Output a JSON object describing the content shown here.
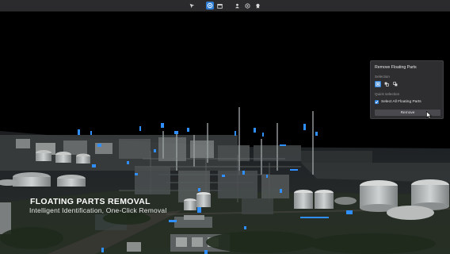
{
  "toolbar": {
    "tools": [
      {
        "icon": "pointer-icon",
        "active": false
      },
      {
        "icon": "floating-parts-icon",
        "active": true
      },
      {
        "icon": "calendar-icon",
        "active": false
      },
      {
        "icon": "person-icon",
        "active": false
      },
      {
        "icon": "globe-icon",
        "active": false
      },
      {
        "icon": "badge-icon",
        "active": false
      }
    ]
  },
  "overlay": {
    "title": "FLOATING PARTS REMOVAL",
    "subtitle": "Intelligent Identification, One-Click Removal"
  },
  "panel": {
    "title": "Remove Floating Parts",
    "selection_label": "Selection",
    "quick_selection_label": "Quick selection",
    "select_all_label": "Select All Floating Parts",
    "select_all_checked": true,
    "remove_button": "Remove"
  },
  "colors": {
    "accent": "#2f7fd6",
    "floating_parts": "#2f8fff",
    "toolbar_bg": "#2b2b2d",
    "panel_bg": "#2e2e31"
  }
}
